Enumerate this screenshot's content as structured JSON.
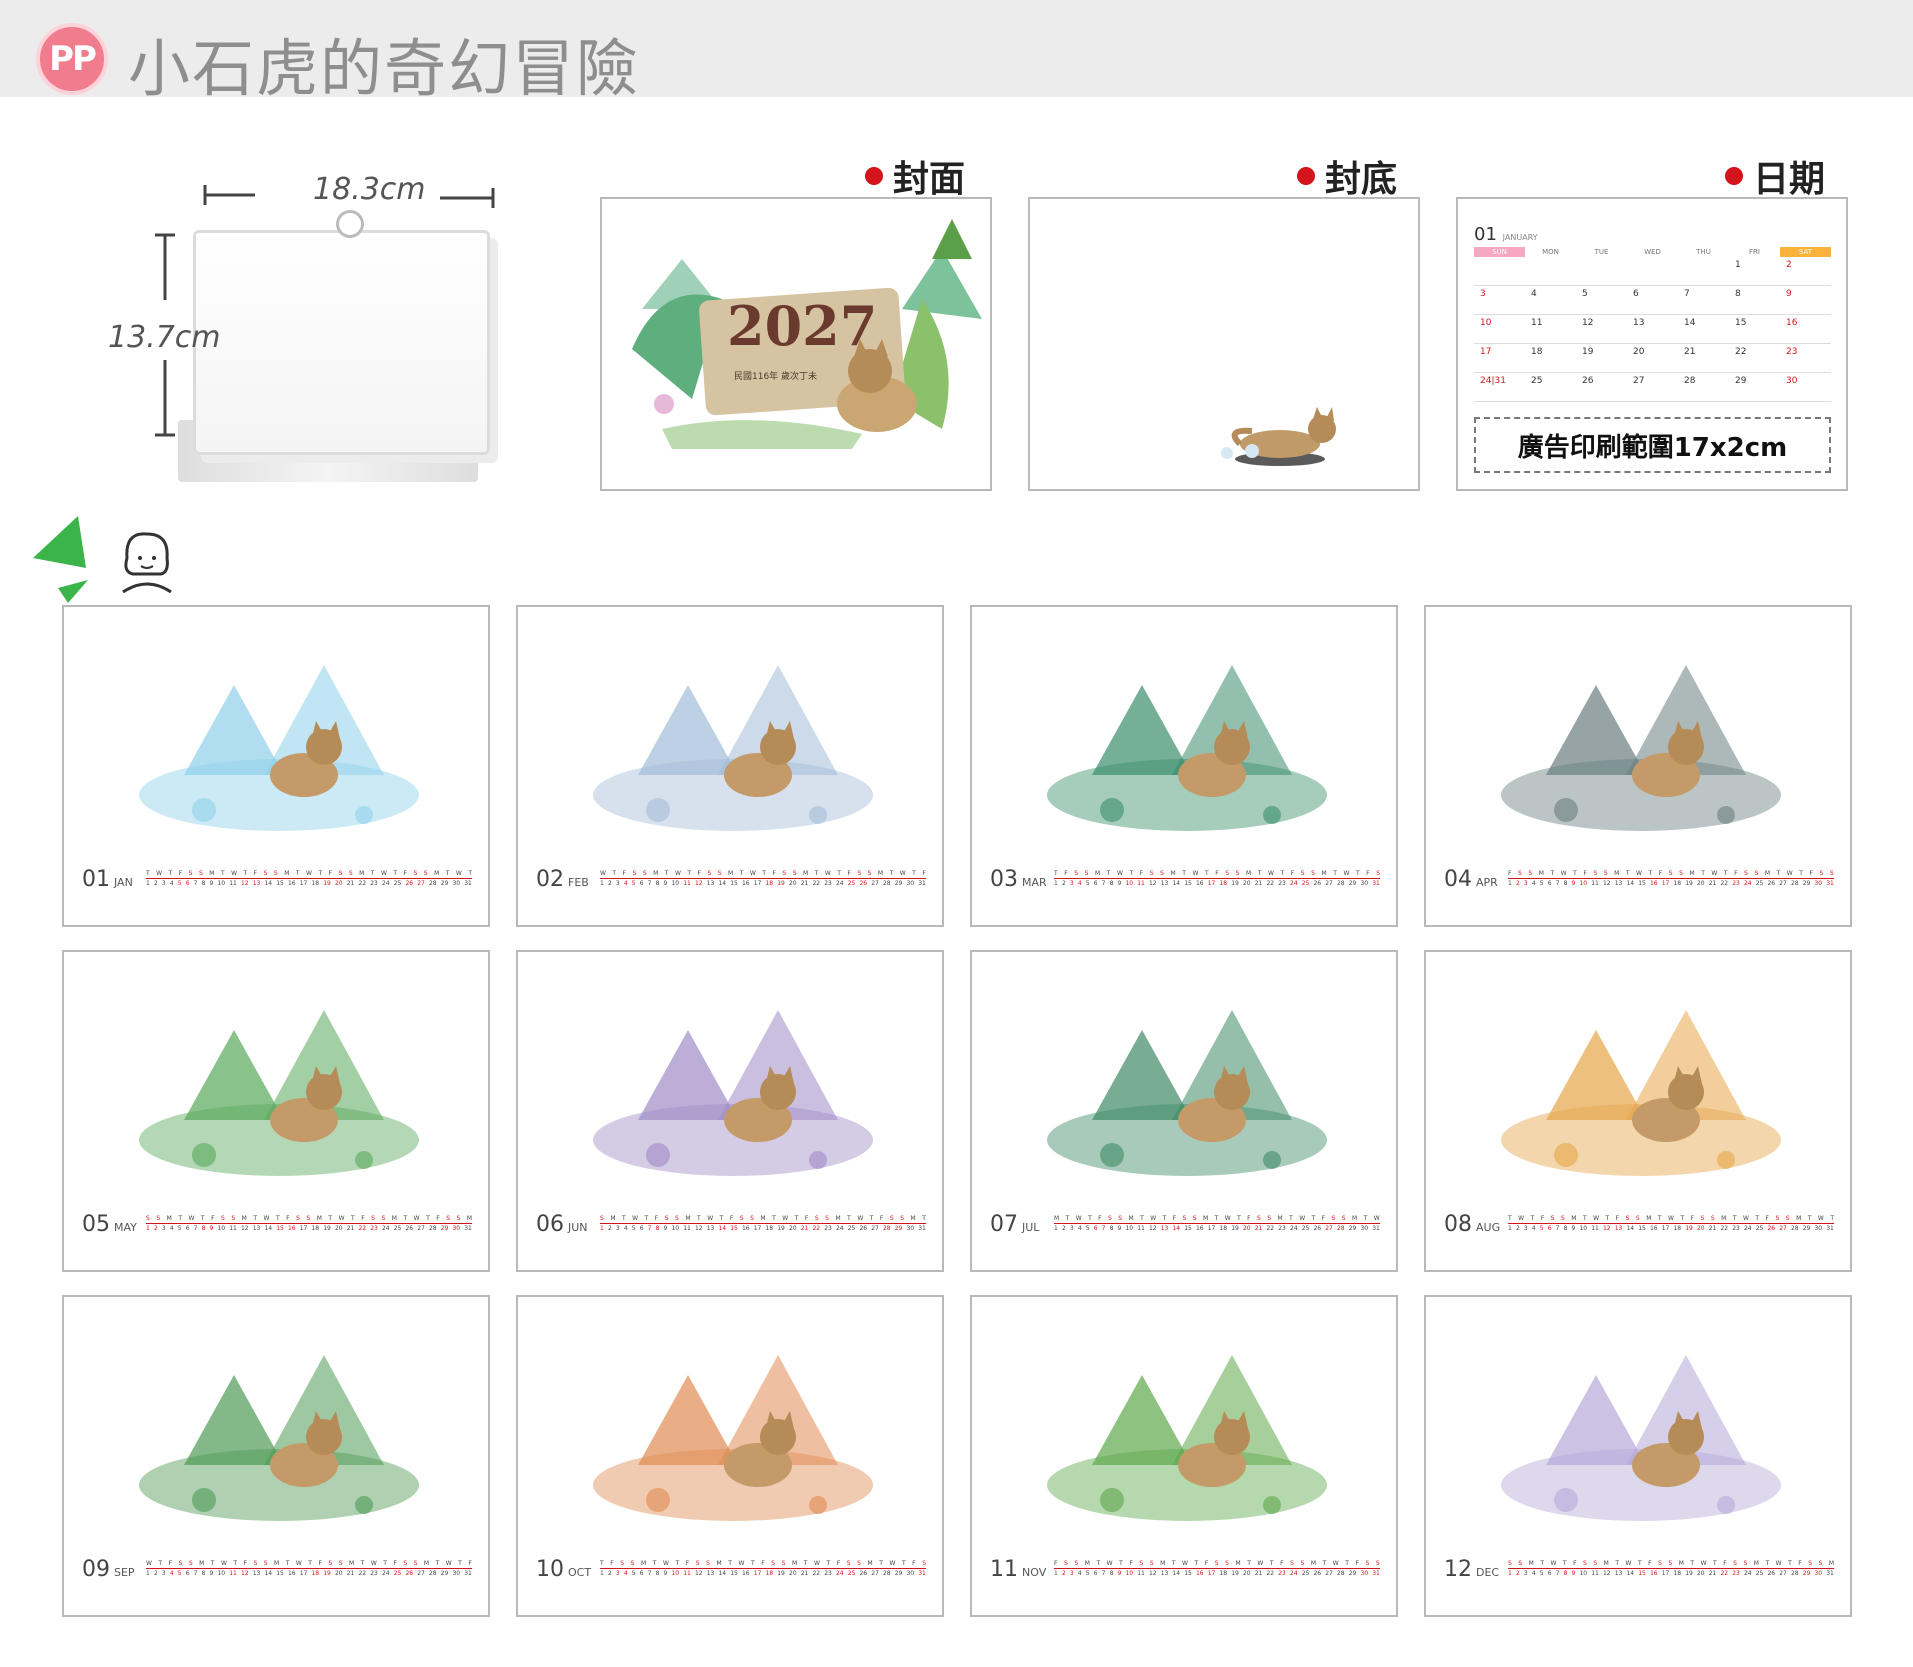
{
  "header": {
    "badge": "PP",
    "title": "小石虎的奇幻冒險"
  },
  "dimensions": {
    "width": "18.3cm",
    "height": "13.7cm"
  },
  "sections": {
    "cover": "封面",
    "back": "封底",
    "date": "日期"
  },
  "cover": {
    "year": "2027",
    "sub": "民國116年 歲次丁未"
  },
  "date_sheet": {
    "month_num": "01",
    "month_name": "JANUARY",
    "weekdays": [
      "SUN",
      "MON",
      "TUE",
      "WED",
      "THU",
      "FRI",
      "SAT"
    ],
    "rows": [
      [
        "",
        "",
        "",
        "",
        "",
        "1",
        "2"
      ],
      [
        "3",
        "4",
        "5",
        "6",
        "7",
        "8",
        "9"
      ],
      [
        "10",
        "11",
        "12",
        "13",
        "14",
        "15",
        "16"
      ],
      [
        "17",
        "18",
        "19",
        "20",
        "21",
        "22",
        "23"
      ],
      [
        "24|31",
        "25",
        "26",
        "27",
        "28",
        "29",
        "30"
      ]
    ],
    "ad_text": "廣告印刷範圍17x2cm"
  },
  "months": [
    {
      "num": "01",
      "abbr": "JAN",
      "color": "#8fd0ea"
    },
    {
      "num": "02",
      "abbr": "FEB",
      "color": "#a3bcd8"
    },
    {
      "num": "03",
      "abbr": "MAR",
      "color": "#3a8d6b"
    },
    {
      "num": "04",
      "abbr": "APR",
      "color": "#6a7e80"
    },
    {
      "num": "05",
      "abbr": "MAY",
      "color": "#58a85a"
    },
    {
      "num": "06",
      "abbr": "JUN",
      "color": "#a08bc6"
    },
    {
      "num": "07",
      "abbr": "JUL",
      "color": "#3f8a66"
    },
    {
      "num": "08",
      "abbr": "AUG",
      "color": "#e6a54a"
    },
    {
      "num": "09",
      "abbr": "SEP",
      "color": "#4e9a55"
    },
    {
      "num": "10",
      "abbr": "OCT",
      "color": "#e08b52"
    },
    {
      "num": "11",
      "abbr": "NOV",
      "color": "#5ea84b"
    },
    {
      "num": "12",
      "abbr": "DEC",
      "color": "#b5a8d8"
    }
  ]
}
